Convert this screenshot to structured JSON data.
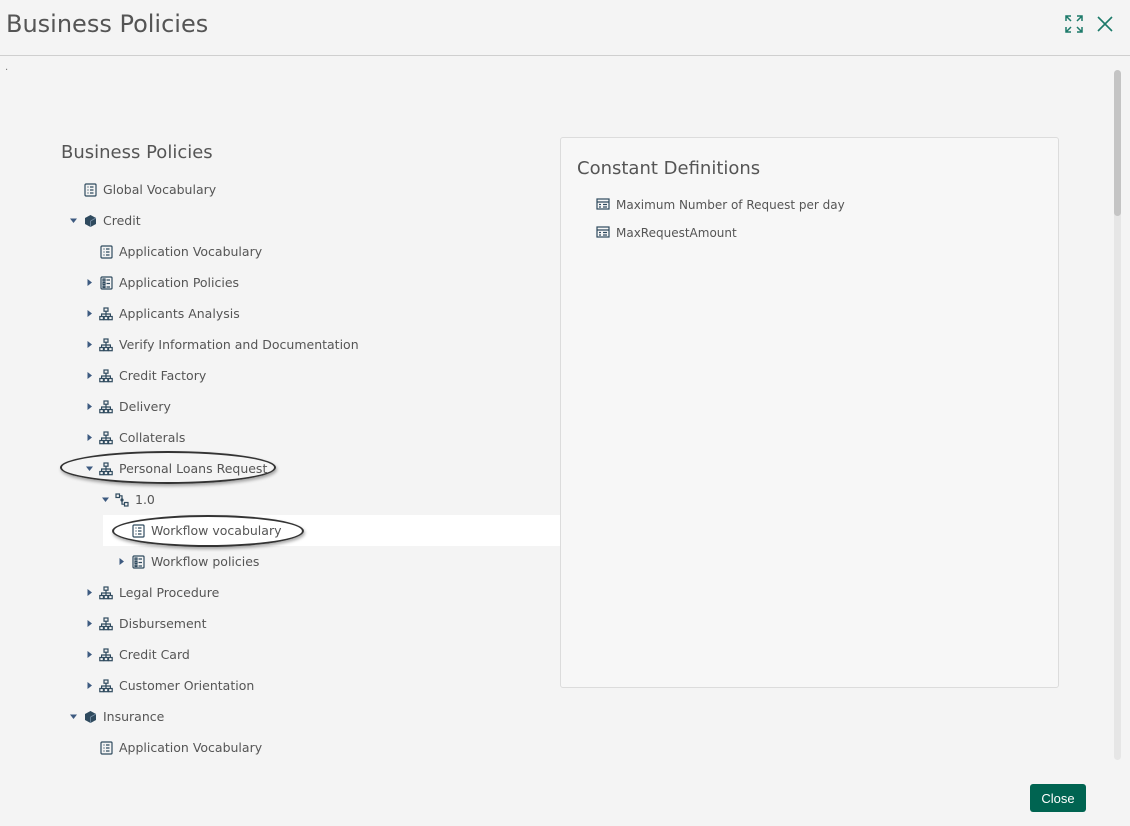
{
  "dialog": {
    "title": "Business Policies",
    "dot": ".",
    "close_label": "Close"
  },
  "tree": {
    "title": "Business Policies",
    "items": [
      {
        "label": "Global Vocabulary",
        "icon": "vocabulary-icon"
      },
      {
        "label": "Credit",
        "icon": "hexagon-icon",
        "state": "expanded"
      },
      {
        "label": "Application Vocabulary",
        "icon": "vocabulary-icon"
      },
      {
        "label": "Application Policies",
        "icon": "policies-icon",
        "state": "collapsed"
      },
      {
        "label": "Applicants Analysis",
        "icon": "hierarchy-icon",
        "state": "collapsed"
      },
      {
        "label": "Verify Information and Documentation",
        "icon": "hierarchy-icon",
        "state": "collapsed"
      },
      {
        "label": "Credit Factory",
        "icon": "hierarchy-icon",
        "state": "collapsed"
      },
      {
        "label": "Delivery",
        "icon": "hierarchy-icon",
        "state": "collapsed"
      },
      {
        "label": "Collaterals",
        "icon": "hierarchy-icon",
        "state": "collapsed"
      },
      {
        "label": "Personal Loans Request",
        "icon": "hierarchy-icon",
        "state": "expanded"
      },
      {
        "label": "1.0",
        "icon": "version-icon",
        "state": "expanded"
      },
      {
        "label": "Workflow vocabulary",
        "icon": "vocabulary-icon",
        "selected": true
      },
      {
        "label": "Workflow policies",
        "icon": "policies-icon",
        "state": "collapsed"
      },
      {
        "label": "Legal Procedure",
        "icon": "hierarchy-icon",
        "state": "collapsed"
      },
      {
        "label": "Disbursement",
        "icon": "hierarchy-icon",
        "state": "collapsed"
      },
      {
        "label": "Credit Card",
        "icon": "hierarchy-icon",
        "state": "collapsed"
      },
      {
        "label": "Customer Orientation",
        "icon": "hierarchy-icon",
        "state": "collapsed"
      },
      {
        "label": "Insurance",
        "icon": "hexagon-icon",
        "state": "expanded"
      },
      {
        "label": "Application Vocabulary",
        "icon": "vocabulary-icon"
      }
    ]
  },
  "constants": {
    "title": "Constant Definitions",
    "items": [
      {
        "label": "Maximum Number of Request per day",
        "icon": "constant-icon"
      },
      {
        "label": "MaxRequestAmount",
        "icon": "constant-icon"
      }
    ]
  },
  "colors": {
    "accent": "#006451",
    "icon": "#2f4a5e",
    "arrow": "#3d5a80"
  }
}
